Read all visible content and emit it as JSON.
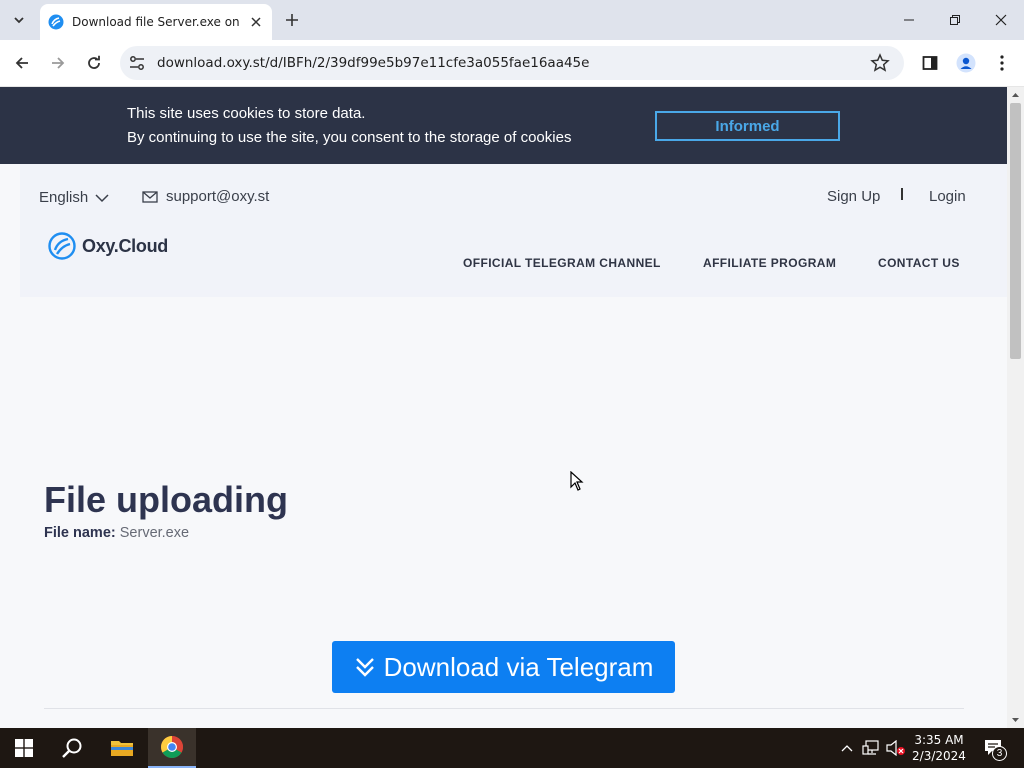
{
  "browser": {
    "tab_title": "Download file Server.exe on Oxy.Cloud",
    "url": "download.oxy.st/d/IBFh/2/39df99e5b97e11cfe3a055fae16aa45e"
  },
  "cookie_banner": {
    "line1": "This site uses cookies to store data.",
    "line2": "By continuing to use the site, you consent to the storage of cookies",
    "button": "Informed"
  },
  "header": {
    "language": "English",
    "support_email": "support@oxy.st",
    "sign_up": "Sign Up",
    "login": "Login",
    "logo_text": "Oxy.Cloud",
    "nav": [
      "OFFICIAL TELEGRAM CHANNEL",
      "AFFILIATE PROGRAM",
      "CONTACT US"
    ]
  },
  "main": {
    "title": "File uploading",
    "file_name_label": "File name:",
    "file_name": "Server.exe",
    "download_button": "Download via Telegram"
  },
  "taskbar": {
    "time": "3:35 AM",
    "date": "2/3/2024",
    "notification_count": "3"
  },
  "colors": {
    "banner": "#2c3346",
    "accent": "#0d7ff2",
    "informed_border": "#4aa8e8"
  }
}
